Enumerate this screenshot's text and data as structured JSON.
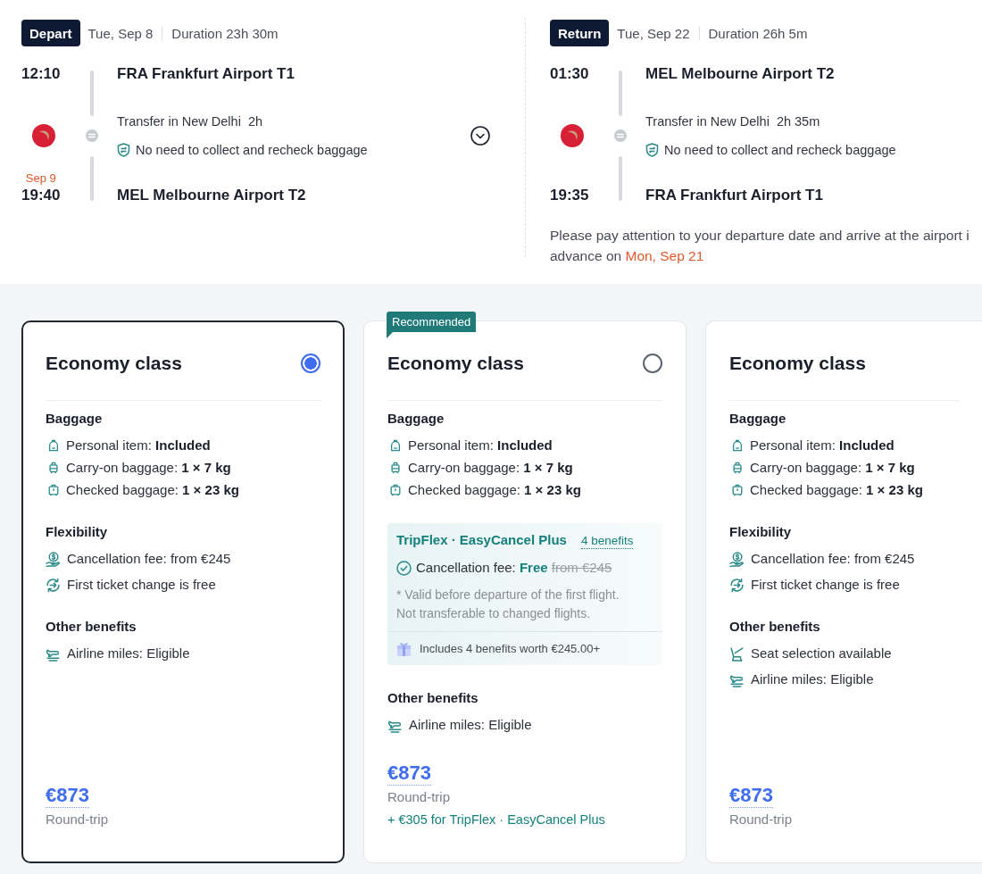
{
  "flights": [
    {
      "label": "Depart",
      "date": "Tue, Sep 8",
      "duration": "Duration 23h 30m",
      "departure": {
        "time": "12:10",
        "airport": "FRA Frankfurt Airport T1"
      },
      "transfer": {
        "place": "Transfer in New Delhi",
        "duration": "2h",
        "baggage_note": "No need to collect and recheck baggage"
      },
      "arrival": {
        "day_note": "Sep 9",
        "time": "19:40",
        "airport": "MEL Melbourne Airport T2"
      },
      "expandable": true
    },
    {
      "label": "Return",
      "date": "Tue, Sep 22",
      "duration": "Duration 26h 5m",
      "departure": {
        "time": "01:30",
        "airport": "MEL Melbourne Airport T2"
      },
      "transfer": {
        "place": "Transfer in New Delhi",
        "duration": "2h 35m",
        "baggage_note": "No need to collect and recheck baggage"
      },
      "arrival": {
        "time": "19:35",
        "airport": "FRA Frankfurt Airport T1"
      },
      "expandable": false,
      "notice": {
        "line_1": "Please pay attention to your departure date and arrive at the airport i",
        "line_2": "advance on",
        "date": "Mon, Sep 21"
      }
    }
  ],
  "cards": [
    {
      "title": "Economy class",
      "selected": true,
      "sections": [
        {
          "kind": "baggage",
          "title": "Baggage",
          "items": [
            {
              "kind": "personal",
              "text": "Personal item: **Included**"
            },
            {
              "kind": "carry_on",
              "text": "Carry-on baggage: **1 × 7 kg**"
            },
            {
              "kind": "checked",
              "text": "Checked baggage: **1 × 23 kg**"
            }
          ]
        },
        {
          "kind": "benefits",
          "title": "Flexibility",
          "items": [
            {
              "kind": "cancellation",
              "text": "Cancellation fee: from €245"
            },
            {
              "kind": "change",
              "text": "First ticket change is free"
            }
          ]
        },
        {
          "kind": "benefits",
          "title": "Other benefits",
          "items": [
            {
              "kind": "miles",
              "text": "Airline miles: Eligible"
            }
          ]
        }
      ],
      "price": "€873",
      "price_note": "Round-trip"
    },
    {
      "badge": "Recommended",
      "title": "Economy class",
      "selected": false,
      "sections": [
        {
          "kind": "baggage",
          "title": "Baggage",
          "items": [
            {
              "kind": "personal",
              "text": "Personal item: **Included**"
            },
            {
              "kind": "carry_on",
              "text": "Carry-on baggage: **1 × 7 kg**"
            },
            {
              "kind": "checked",
              "text": "Checked baggage: **1 × 23 kg**"
            }
          ]
        },
        {
          "kind": "offer",
          "title": "TripFlex · EasyCancel Plus",
          "link": "4 benefits",
          "fee_label": "Cancellation fee:",
          "fee_value": "Free",
          "fee_old": "from €245",
          "notes": [
            "* Valid before departure of the first flight.",
            "Not transferable to changed flights."
          ],
          "summary": "Includes 4 benefits worth €245.00+"
        },
        {
          "kind": "benefits",
          "title": "Other benefits",
          "items": [
            {
              "kind": "miles",
              "text": "Airline miles: Eligible"
            }
          ]
        }
      ],
      "price": "€873",
      "price_note": "Round-trip",
      "extra": "+ €305 for TripFlex · EasyCancel Plus"
    },
    {
      "title": "Economy class",
      "selected": false,
      "cut_off": true,
      "sections": [
        {
          "kind": "baggage",
          "title": "Baggage",
          "items": [
            {
              "kind": "personal",
              "text": "Personal item: **Included**"
            },
            {
              "kind": "carry_on",
              "text": "Carry-on baggage: **1 × 7 kg**"
            },
            {
              "kind": "checked",
              "text": "Checked baggage: **1 × 23 kg**"
            }
          ]
        },
        {
          "kind": "benefits",
          "title": "Flexibility",
          "items": [
            {
              "kind": "cancellation",
              "text": "Cancellation fee: from €245"
            },
            {
              "kind": "change",
              "text": "First ticket change is free"
            }
          ]
        },
        {
          "kind": "benefits",
          "title": "Other benefits",
          "items": [
            {
              "kind": "seat",
              "text": "Seat selection available"
            },
            {
              "kind": "miles",
              "text": "Airline miles: Eligible"
            }
          ]
        }
      ],
      "price": "€873",
      "price_note": "Round-trip"
    }
  ]
}
